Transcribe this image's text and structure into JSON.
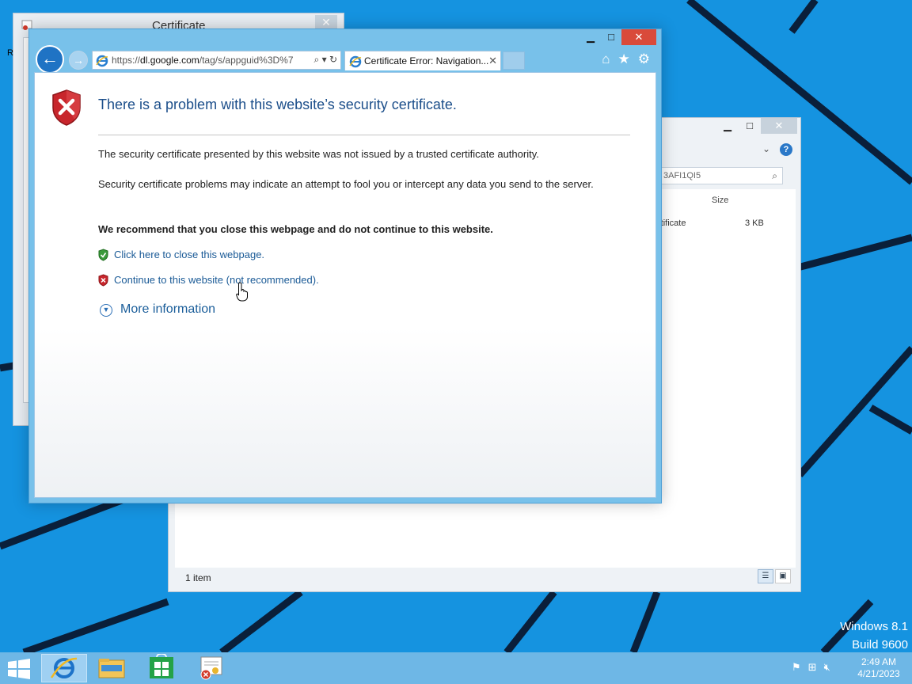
{
  "certificate_window": {
    "title": "Certificate",
    "close": "✕",
    "side_label": "R"
  },
  "explorer": {
    "minimize": "▁",
    "maximize": "□",
    "close": "✕",
    "chevron": "⌄",
    "help": "?",
    "search_value": "3AFI1QI5",
    "column_size": "Size",
    "file_name": "rtificate",
    "file_size": "3 KB",
    "status": "1 item"
  },
  "ie": {
    "minimize": "▁",
    "maximize": "□",
    "close": "✕",
    "back": "←",
    "forward": "→",
    "address_prefix": "https://",
    "address_domain": "dl.google.com",
    "address_rest": "/tag/s/appguid%3D%7",
    "address_tools": "⌕ ▾ ↻",
    "tab_title": "Certificate Error: Navigation...",
    "tab_close": "✕",
    "home_icon": "⌂",
    "favorites_icon": "★",
    "settings_icon": "⚙",
    "content": {
      "heading": "There is a problem with this website’s security certificate.",
      "p1": "The security certificate presented by this website was not issued by a trusted certificate authority.",
      "p2": "Security certificate problems may indicate an attempt to fool you or intercept any data you send to the server.",
      "recommend": "We recommend that you close this webpage and do not continue to this website.",
      "close_link": "Click here to close this webpage.",
      "continue_link": "Continue to this website (not recommended).",
      "more_info": "More information",
      "more_info_icon": "▼"
    }
  },
  "watermark": {
    "line1": "Windows 8.1",
    "line2": "Build 9600"
  },
  "taskbar": {
    "clock_time": "2:49 AM",
    "clock_date": "4/21/2023",
    "tray_icons": [
      "flag-icon",
      "network-icon",
      "volume-muted-icon"
    ]
  },
  "colors": {
    "desktop": "#1593e0",
    "accent": "#1f73c4",
    "close_red": "#d94a3a",
    "link": "#1a5a96",
    "heading": "#1b4e8a"
  }
}
